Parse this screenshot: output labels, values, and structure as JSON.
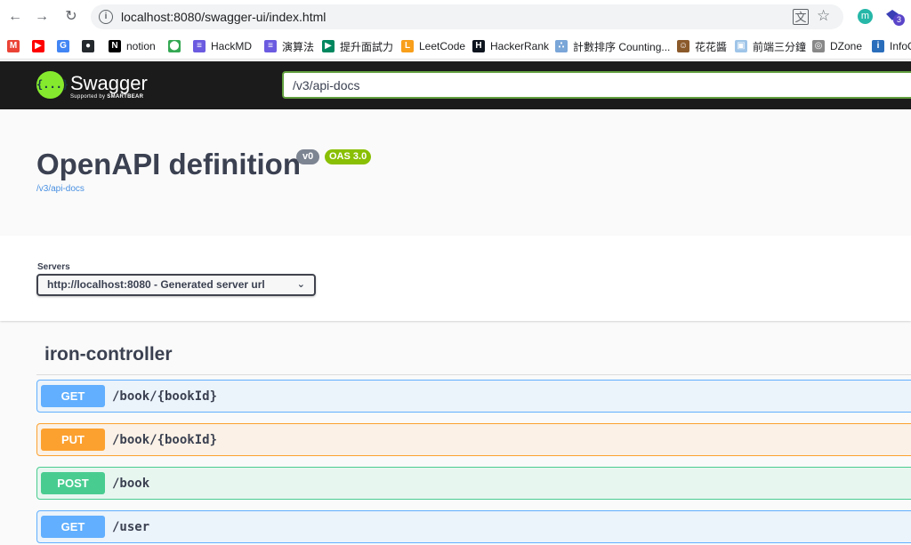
{
  "browser": {
    "url": "localhost:8080/swagger-ui/index.html",
    "profile_initial": "m",
    "extension_badge": "3",
    "bookmarks": [
      {
        "label": "",
        "icon": "gmail-icon",
        "color": "#ea4335",
        "glyph": "M"
      },
      {
        "label": "",
        "icon": "youtube-icon",
        "color": "#ff0000",
        "glyph": "▶"
      },
      {
        "label": "",
        "icon": "translate-icon",
        "color": "#4285f4",
        "glyph": "G"
      },
      {
        "label": "",
        "icon": "github-icon",
        "color": "#24292e",
        "glyph": "●"
      },
      {
        "label": "notion",
        "icon": "notion-icon",
        "color": "#000000",
        "glyph": "N"
      },
      {
        "label": "",
        "icon": "maps-icon",
        "color": "#34a853",
        "glyph": "⬤"
      },
      {
        "label": "HackMD",
        "icon": "hackmd-icon",
        "color": "#6b5be0",
        "glyph": "≡"
      },
      {
        "label": "演算法",
        "icon": "hackmd-icon",
        "color": "#6b5be0",
        "glyph": "≡"
      },
      {
        "label": "提升面試力",
        "icon": "play-icon",
        "color": "#01875f",
        "glyph": "▶"
      },
      {
        "label": "LeetCode",
        "icon": "leetcode-icon",
        "color": "#f89f1b",
        "glyph": "L"
      },
      {
        "label": "HackerRank",
        "icon": "hackerrank-icon",
        "color": "#0e141e",
        "glyph": "H"
      },
      {
        "label": "計數排序 Counting...",
        "icon": "graph-icon",
        "color": "#7aa6d8",
        "glyph": "∴"
      },
      {
        "label": "花花醬",
        "icon": "avatar-icon",
        "color": "#8b5a2b",
        "glyph": "☺"
      },
      {
        "label": "前端三分鐘",
        "icon": "image-icon",
        "color": "#9fc5e8",
        "glyph": "▣"
      },
      {
        "label": "DZone",
        "icon": "dzone-icon",
        "color": "#888888",
        "glyph": "◎"
      },
      {
        "label": "InfoQ",
        "icon": "infoq-icon",
        "color": "#2a6ebb",
        "glyph": "i"
      }
    ]
  },
  "topbar": {
    "logo_mark": "{...}",
    "logo_text": "Swagger",
    "logo_sub_prefix": "Supported by ",
    "logo_sub_brand": "SMARTBEAR",
    "api_url": "/v3/api-docs"
  },
  "info": {
    "title": "OpenAPI definition",
    "version": "v0",
    "oas": "OAS 3.0",
    "spec_link": "/v3/api-docs"
  },
  "servers": {
    "label": "Servers",
    "selected": "http://localhost:8080 - Generated server url"
  },
  "tag": {
    "name": "iron-controller",
    "operations": [
      {
        "method": "GET",
        "path": "/book/{bookId}",
        "kind": "get"
      },
      {
        "method": "PUT",
        "path": "/book/{bookId}",
        "kind": "put"
      },
      {
        "method": "POST",
        "path": "/book",
        "kind": "post"
      },
      {
        "method": "GET",
        "path": "/user",
        "kind": "get"
      }
    ]
  },
  "colors": {
    "get": "#61affe",
    "put": "#fca130",
    "post": "#49cc90",
    "swagger_green": "#85ea2d",
    "topbar_bg": "#1b1b1b"
  }
}
